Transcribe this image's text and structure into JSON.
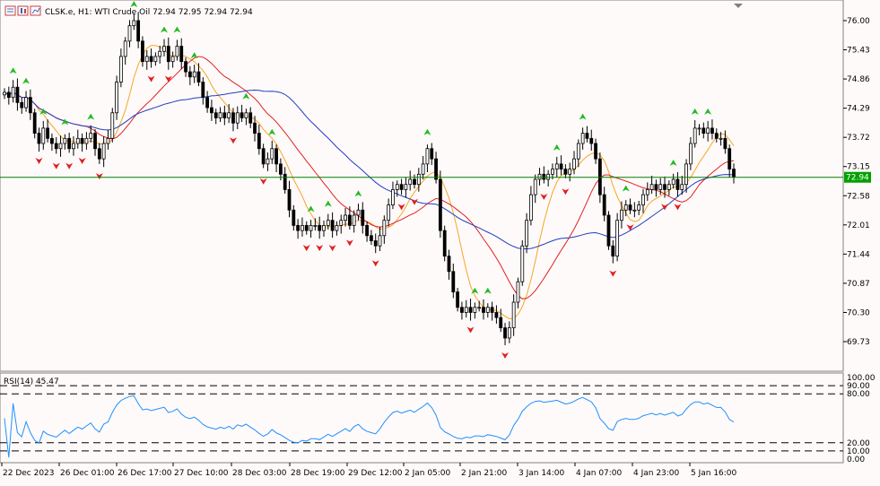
{
  "header": {
    "symbol": "CLSK.e",
    "timeframe": "H1",
    "title_text": "CLSK.e, H1:  WTI Crude Oil  72.94 72.95 72.94 72.94",
    "icons": [
      "bar-chart-icon",
      "candle-chart-icon",
      "line-chart-icon"
    ]
  },
  "price": {
    "current": "72.94",
    "badge_color": "#00a000"
  },
  "colors": {
    "background": "#fffafa",
    "bull_body": "#ffffff",
    "bear_body": "#000000",
    "ma_fast": "#f5a623",
    "ma_mid": "#e02020",
    "ma_slow": "#1f3fbf",
    "rsi_line": "#1e90ff",
    "current_line": "#008000",
    "up_arrow": "#22bb22",
    "down_arrow": "#e02020"
  },
  "y_axis": {
    "ticks": [
      "76.00",
      "75.43",
      "74.86",
      "74.29",
      "73.72",
      "73.15",
      "72.58",
      "72.01",
      "71.44",
      "70.87",
      "70.30",
      "69.73"
    ]
  },
  "x_axis": {
    "ticks": [
      "22 Dec 2023",
      "26 Dec 01:00",
      "26 Dec 17:00",
      "27 Dec 10:00",
      "28 Dec 03:00",
      "28 Dec 19:00",
      "29 Dec 12:00",
      "2 Jan 05:00",
      "2 Jan 21:00",
      "3 Jan 14:00",
      "4 Jan 07:00",
      "4 Jan 23:00",
      "5 Jan 16:00"
    ]
  },
  "rsi": {
    "label": "RSI(14) 45.47",
    "ticks": [
      "100.00",
      "90.00",
      "80.00",
      "20.00",
      "10.00",
      "0.00"
    ],
    "levels": [
      90,
      80,
      20,
      10
    ]
  },
  "chart_data": {
    "type": "candlestick",
    "closes": [
      74.6,
      74.5,
      74.7,
      74.4,
      74.3,
      74.5,
      74.2,
      73.8,
      73.6,
      73.9,
      73.7,
      73.6,
      73.5,
      73.6,
      73.7,
      73.5,
      73.6,
      73.7,
      73.6,
      73.7,
      73.8,
      73.5,
      73.3,
      73.6,
      73.7,
      74.2,
      74.8,
      75.3,
      75.6,
      75.9,
      76.0,
      75.6,
      75.2,
      75.3,
      75.2,
      75.3,
      75.4,
      75.5,
      75.2,
      75.3,
      75.5,
      75.2,
      75.0,
      74.9,
      75.0,
      74.8,
      74.5,
      74.3,
      74.2,
      74.1,
      74.2,
      74.1,
      74.2,
      74.0,
      74.2,
      74.1,
      74.2,
      74.0,
      73.8,
      73.5,
      73.2,
      73.3,
      73.5,
      73.2,
      73.0,
      72.7,
      72.3,
      72.0,
      71.9,
      72.0,
      71.9,
      72.0,
      72.0,
      71.9,
      72.0,
      72.1,
      71.9,
      72.0,
      72.1,
      72.2,
      72.0,
      72.2,
      72.3,
      72.0,
      71.8,
      71.7,
      71.6,
      71.8,
      72.1,
      72.4,
      72.7,
      72.8,
      72.7,
      72.8,
      72.9,
      72.8,
      73.0,
      73.2,
      73.5,
      73.3,
      72.9,
      71.9,
      71.4,
      71.1,
      70.7,
      70.4,
      70.3,
      70.4,
      70.3,
      70.4,
      70.4,
      70.3,
      70.4,
      70.3,
      70.2,
      70.0,
      69.8,
      70.0,
      70.5,
      70.9,
      71.6,
      72.1,
      72.6,
      72.9,
      73.0,
      72.9,
      73.0,
      73.1,
      73.2,
      73.1,
      73.0,
      73.1,
      73.3,
      73.6,
      73.8,
      73.7,
      73.6,
      73.3,
      72.6,
      72.2,
      71.6,
      71.4,
      72.1,
      72.3,
      72.4,
      72.3,
      72.3,
      72.4,
      72.6,
      72.7,
      72.8,
      72.7,
      72.8,
      72.7,
      72.8,
      72.9,
      72.7,
      72.8,
      73.2,
      73.6,
      73.9,
      73.9,
      73.8,
      73.9,
      73.8,
      73.7,
      73.7,
      73.5,
      73.1,
      72.94
    ],
    "ylim": [
      69.5,
      76.2
    ],
    "indicators": [
      "MA fast",
      "MA mid",
      "MA slow",
      "RSI(14)"
    ],
    "rsi_last": 45.47
  }
}
